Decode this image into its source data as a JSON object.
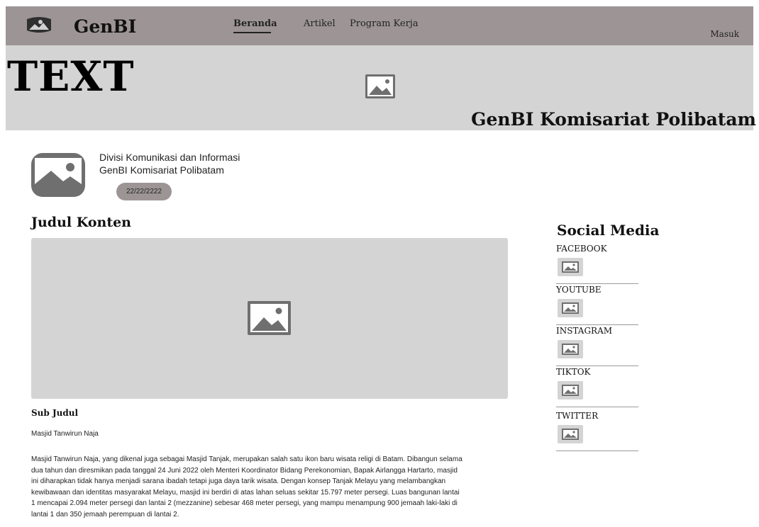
{
  "nav": {
    "brand": "GenBI",
    "links": [
      "Beranda",
      "Artikel",
      "Program Kerja"
    ],
    "login": "Masuk"
  },
  "banner": {
    "title": "TEXT",
    "subtitle": "GenBI Komisariat Polibatam",
    "image_icon": "image-placeholder-icon"
  },
  "author": {
    "name": "Divisi Komunikasi dan Informasi",
    "org": "GenBI Komisariat Polibatam",
    "date": "22/22/2222"
  },
  "content": {
    "title": "Judul Konten",
    "subtitle": "Sub Judul",
    "lead": "Masjid Tanwirun Naja",
    "lines": [
      "Masjid Tanwirun Naja, yang dikenal juga sebagai Masjid Tanjak, merupakan salah satu ikon baru wisata religi di Batam. Dibangun selama",
      "dua tahun dan diresmikan pada tanggal 24 Juni 2022 oleh Menteri Koordinator Bidang Perekonomian, Bapak Airlangga Hartarto, masjid",
      "ini diharapkan tidak hanya menjadi sarana ibadah tetapi juga daya tarik wisata. Dengan konsep Tanjak Melayu yang melambangkan",
      "kewibawaan dan identitas masyarakat Melayu, masjid ini berdiri di atas lahan seluas sekitar 15.797 meter persegi. Luas bangunan lantai",
      "1 mencapai 2.094 meter persegi dan lantai 2 (mezzanine) sebesar 468 meter persegi, yang mampu menampung 900 jemaah laki-laki di",
      "lantai 1 dan 350 jemaah perempuan di lantai 2."
    ]
  },
  "social": {
    "title": "Social Media",
    "items": [
      "FACEBOOK",
      "YOUTUBE",
      "INSTAGRAM",
      "TIKTOK",
      "TWITTER"
    ]
  },
  "colors": {
    "nav_bg": "#9d9595",
    "banner_bg": "#d4d4d4",
    "placeholder": "#6f6f6f"
  }
}
